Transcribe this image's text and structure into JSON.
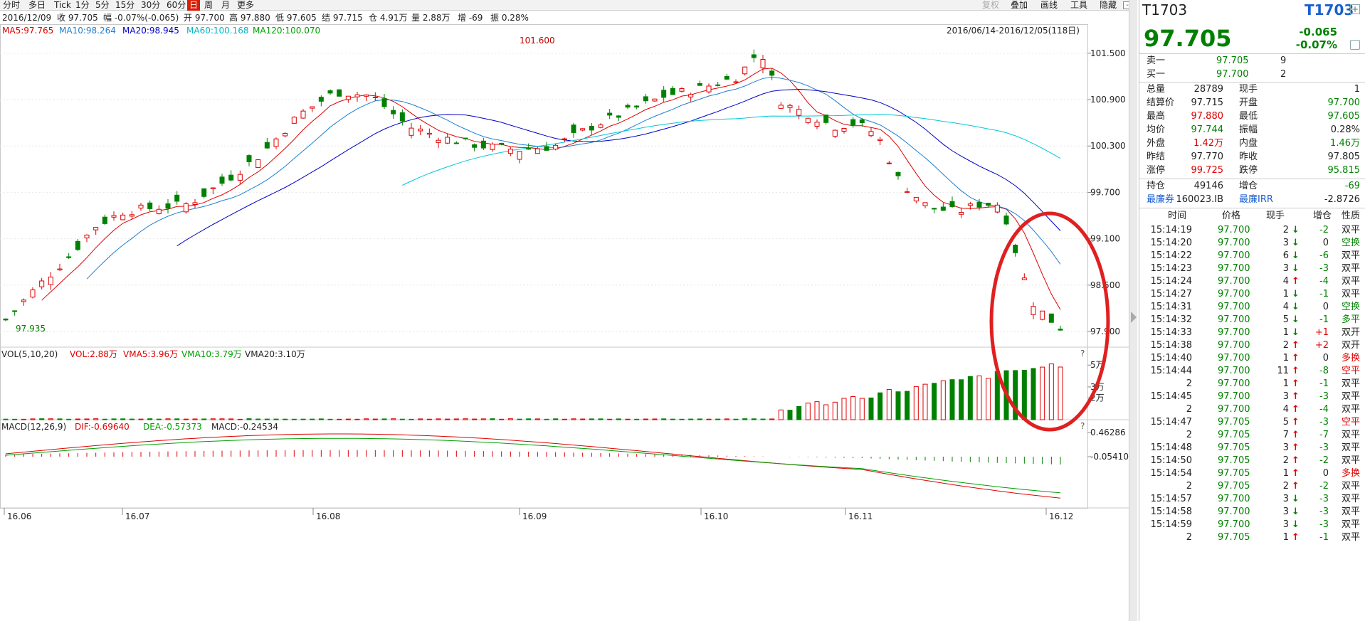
{
  "toolbar": {
    "periods": [
      "分时",
      "多日",
      "Tick",
      "1分",
      "5分",
      "15分",
      "30分",
      "60分",
      "日",
      "周",
      "月",
      "更多"
    ],
    "active": "日",
    "right_items": [
      {
        "label": "复权",
        "enabled": false
      },
      {
        "label": "叠加",
        "enabled": true
      },
      {
        "label": "画线",
        "enabled": true
      },
      {
        "label": "工具",
        "enabled": true
      },
      {
        "label": "隐藏",
        "enabled": true
      }
    ],
    "minus": "-",
    "plus": "+"
  },
  "info": {
    "date": "2016/12/09",
    "close": "收 97.705",
    "change": "幅 -0.07%(-0.065)",
    "open": "开 97.700",
    "high": "高 97.880",
    "low": "低 97.605",
    "settle": "结 97.715",
    "oi": "仓 4.91万",
    "vol": "量 2.88万",
    "oi_change": "增 -69",
    "amp": "振 0.28%"
  },
  "ma": {
    "ma5": "MA5:97.765",
    "ma10": "MA10:98.264",
    "ma20": "MA20:98.945",
    "ma60": "MA60:100.168",
    "ma120": "MA120:100.070"
  },
  "range_label": "2016/06/14-2016/12/05(118日)",
  "colors": {
    "up": "#e00000",
    "down": "#008000",
    "ma5": "#e00000",
    "ma10": "#1f7fd0",
    "ma20": "#0000c8",
    "ma60": "#00c8d8",
    "ma120": "#00a000",
    "highlight": "#e02020"
  },
  "chart_data": {
    "type": "candlestick",
    "price_axis": {
      "ticks": [
        "101.500",
        "100.900",
        "100.300",
        "99.700",
        "99.100",
        "98.500",
        "97.900"
      ],
      "ylim": [
        97.8,
        101.8
      ]
    },
    "max_label": "101.600",
    "min_label": "97.935",
    "date_ticks": [
      "16.06",
      "16.07",
      "16.08",
      "16.09",
      "16.10",
      "16.11",
      "16.12"
    ],
    "volume": {
      "legend": [
        "VOL(5,10,20)",
        "VOL:2.88万",
        "VMA5:3.96万",
        "VMA10:3.79万",
        "VMA20:3.10万"
      ],
      "ticks": [
        "5万",
        "3万",
        "2万"
      ]
    },
    "macd": {
      "legend": [
        "MACD(12,26,9)",
        "DIF:-0.69640",
        "DEA:-0.57373",
        "MACD:-0.24534"
      ],
      "ticks": [
        "0.46286",
        "-0.05410"
      ]
    },
    "question": "?"
  },
  "quote": {
    "code": "T1703",
    "code_link": "T1703",
    "price": "97.705",
    "change": "-0.065",
    "change_pct": "-0.07%",
    "sell1_label": "卖一",
    "sell1_price": "97.705",
    "sell1_vol": "9",
    "buy1_label": "买一",
    "buy1_price": "97.700",
    "buy1_vol": "2",
    "stats": [
      {
        "l1": "总量",
        "v1": "28789",
        "c1": "",
        "l2": "现手",
        "v2": "1",
        "c2": ""
      },
      {
        "l1": "结算价",
        "v1": "97.715",
        "c1": "",
        "l2": "开盘",
        "v2": "97.700",
        "c2": "grn"
      },
      {
        "l1": "最高",
        "v1": "97.880",
        "c1": "red",
        "l2": "最低",
        "v2": "97.605",
        "c2": "grn"
      },
      {
        "l1": "均价",
        "v1": "97.744",
        "c1": "grn",
        "l2": "振幅",
        "v2": "0.28%",
        "c2": ""
      },
      {
        "l1": "外盘",
        "v1": "1.42万",
        "c1": "red",
        "l2": "内盘",
        "v2": "1.46万",
        "c2": "grn"
      },
      {
        "l1": "昨结",
        "v1": "97.770",
        "c1": "",
        "l2": "昨收",
        "v2": "97.805",
        "c2": ""
      },
      {
        "l1": "涨停",
        "v1": "99.725",
        "c1": "red",
        "l2": "跌停",
        "v2": "95.815",
        "c2": "grn"
      }
    ],
    "oi_label": "持仓",
    "oi": "49146",
    "oi_chg_label": "增仓",
    "oi_chg": "-69",
    "ctd_label": "最廉券",
    "ctd": "160023.IB",
    "irr_label": "最廉IRR",
    "irr": "-2.8726",
    "ticks_header": [
      "时间",
      "价格",
      "现手",
      "增仓",
      "性质"
    ],
    "ticks": [
      [
        "15:14:19",
        "97.700",
        "2",
        "down",
        "-2",
        "双平"
      ],
      [
        "15:14:20",
        "97.700",
        "3",
        "down",
        "0",
        "空换"
      ],
      [
        "15:14:22",
        "97.700",
        "6",
        "down",
        "-6",
        "双平"
      ],
      [
        "15:14:23",
        "97.700",
        "3",
        "down",
        "-3",
        "双平"
      ],
      [
        "15:14:24",
        "97.700",
        "4",
        "up",
        "-4",
        "双平"
      ],
      [
        "15:14:27",
        "97.700",
        "1",
        "down",
        "-1",
        "双平"
      ],
      [
        "15:14:31",
        "97.700",
        "4",
        "down",
        "0",
        "空换"
      ],
      [
        "15:14:32",
        "97.700",
        "5",
        "down",
        "-1",
        "多平"
      ],
      [
        "15:14:33",
        "97.700",
        "1",
        "down",
        "+1",
        "双开"
      ],
      [
        "15:14:38",
        "97.700",
        "2",
        "up",
        "+2",
        "双开"
      ],
      [
        "15:14:40",
        "97.700",
        "1",
        "up",
        "0",
        "多换"
      ],
      [
        "15:14:44",
        "97.700",
        "11",
        "up",
        "-8",
        "空平"
      ],
      [
        "2",
        "97.700",
        "1",
        "up",
        "-1",
        "双平"
      ],
      [
        "15:14:45",
        "97.700",
        "3",
        "up",
        "-3",
        "双平"
      ],
      [
        "2",
        "97.700",
        "4",
        "up",
        "-4",
        "双平"
      ],
      [
        "15:14:47",
        "97.705",
        "5",
        "up",
        "-3",
        "空平"
      ],
      [
        "2",
        "97.705",
        "7",
        "up",
        "-7",
        "双平"
      ],
      [
        "15:14:48",
        "97.705",
        "3",
        "up",
        "-3",
        "双平"
      ],
      [
        "15:14:50",
        "97.705",
        "2",
        "up",
        "-2",
        "双平"
      ],
      [
        "15:14:54",
        "97.705",
        "1",
        "up",
        "0",
        "多换"
      ],
      [
        "2",
        "97.705",
        "2",
        "up",
        "-2",
        "双平"
      ],
      [
        "15:14:57",
        "97.700",
        "3",
        "down",
        "-3",
        "双平"
      ],
      [
        "15:14:58",
        "97.700",
        "3",
        "down",
        "-3",
        "双平"
      ],
      [
        "15:14:59",
        "97.700",
        "3",
        "down",
        "-3",
        "双平"
      ],
      [
        "2",
        "97.705",
        "1",
        "up",
        "-1",
        "双平"
      ]
    ]
  }
}
